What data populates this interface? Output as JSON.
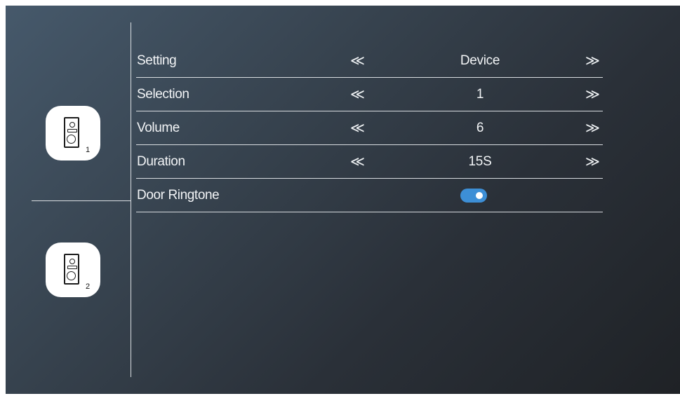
{
  "devices": [
    {
      "icon": "doorbell-icon",
      "number": "1"
    },
    {
      "icon": "doorbell-icon",
      "number": "2"
    }
  ],
  "settings": [
    {
      "label": "Setting",
      "value": "Device",
      "prev": "≪",
      "next": "≫"
    },
    {
      "label": "Selection",
      "value": "1",
      "prev": "≪",
      "next": "≫"
    },
    {
      "label": "Volume",
      "value": "6",
      "prev": "≪",
      "next": "≫"
    },
    {
      "label": "Duration",
      "value": "15S",
      "prev": "≪",
      "next": "≫"
    }
  ],
  "door_ringtone": {
    "label": "Door Ringtone",
    "enabled": true,
    "color": "#3d8fd6"
  }
}
